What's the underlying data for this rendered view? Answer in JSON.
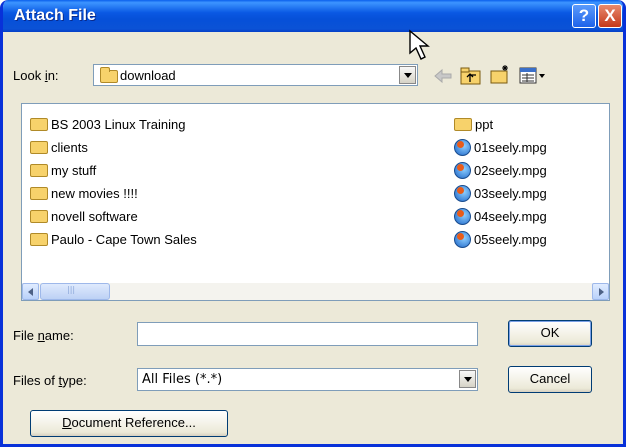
{
  "title": "Attach File",
  "titlebar": {
    "help_label": "?",
    "close_label": "X"
  },
  "lookin": {
    "label_pre": "Look ",
    "label_key": "i",
    "label_post": "n:",
    "value": "download"
  },
  "files_left": [
    {
      "name": "BS 2003 Linux Training",
      "type": "folder"
    },
    {
      "name": "clients",
      "type": "folder"
    },
    {
      "name": "my stuff",
      "type": "folder"
    },
    {
      "name": "new movies !!!!",
      "type": "folder"
    },
    {
      "name": "novell software",
      "type": "folder"
    },
    {
      "name": "Paulo - Cape Town Sales",
      "type": "folder"
    }
  ],
  "files_right": [
    {
      "name": "ppt",
      "type": "folder"
    },
    {
      "name": "01seely.mpg",
      "type": "video"
    },
    {
      "name": "02seely.mpg",
      "type": "video"
    },
    {
      "name": "03seely.mpg",
      "type": "video"
    },
    {
      "name": "04seely.mpg",
      "type": "video"
    },
    {
      "name": "05seely.mpg",
      "type": "video"
    }
  ],
  "filename": {
    "label_pre": "File ",
    "label_key": "n",
    "label_post": "ame:",
    "value": ""
  },
  "filetype": {
    "label_pre": "Files of ",
    "label_key": "t",
    "label_post": "ype:",
    "value": "All Files (*.*)"
  },
  "buttons": {
    "ok": "OK",
    "cancel": "Cancel",
    "docref_key": "D",
    "docref_rest": "ocument Reference..."
  },
  "colors": {
    "titlebar": "#0a58e3",
    "dialog_bg": "#ece9d8",
    "close": "#c4391a"
  }
}
